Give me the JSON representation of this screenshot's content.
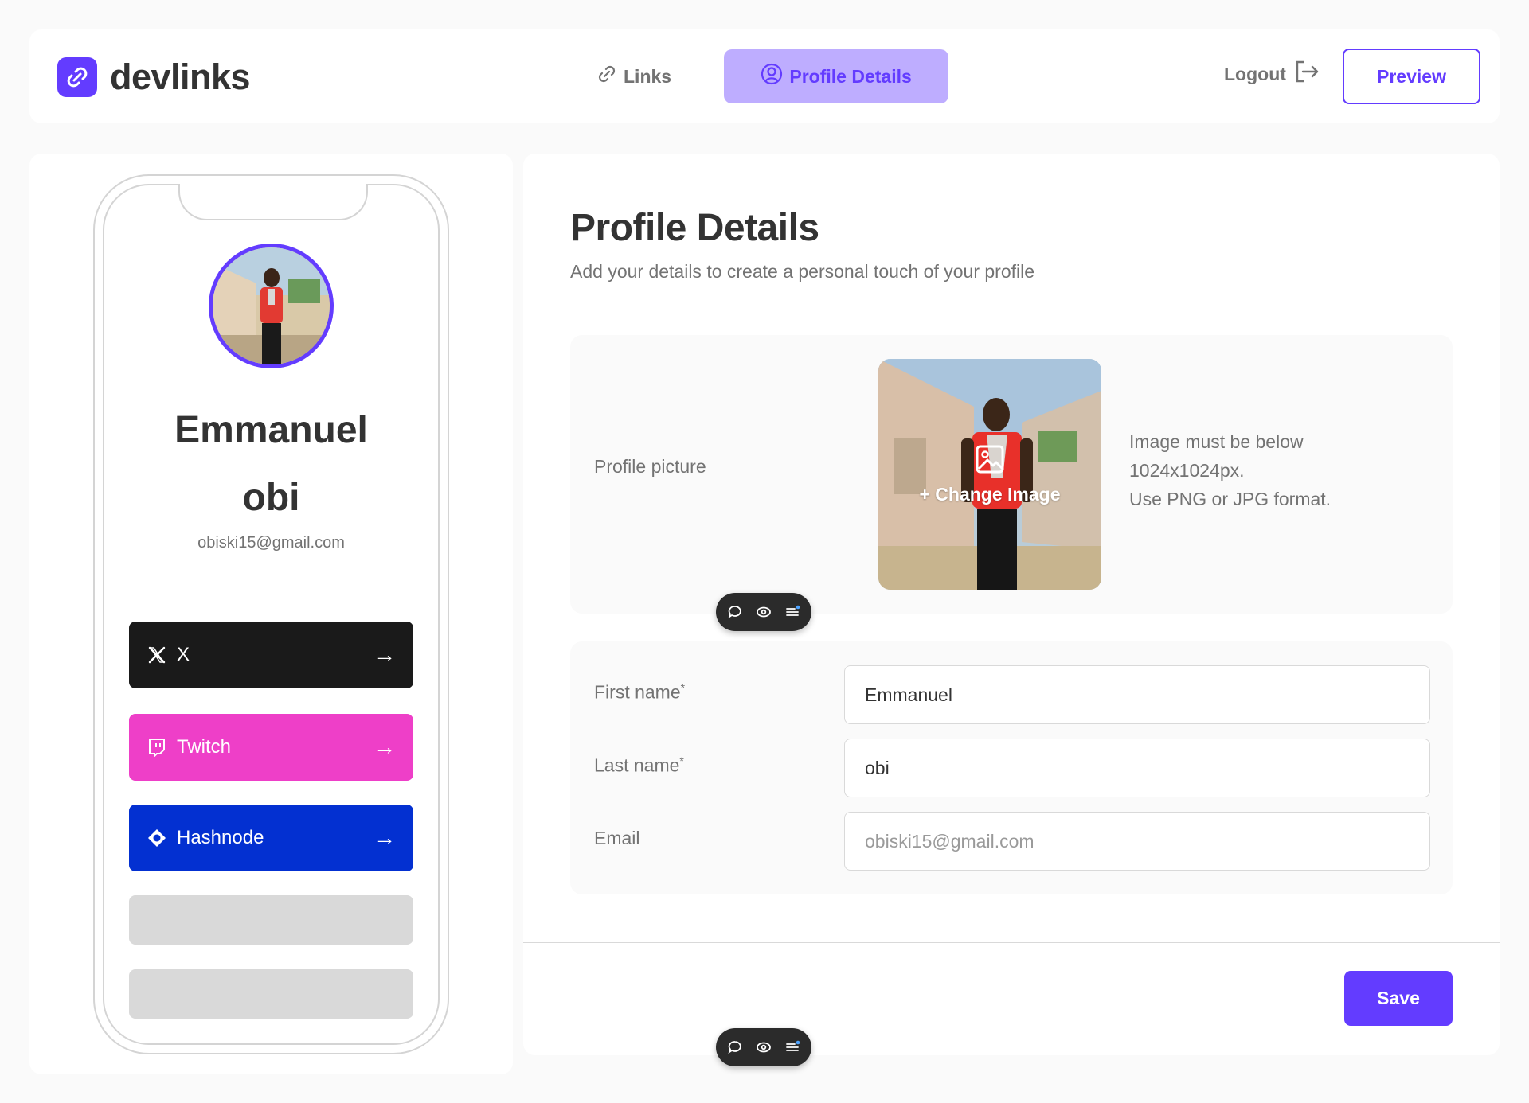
{
  "header": {
    "brand": "devlinks",
    "tabs": [
      {
        "label": "Links",
        "icon": "link-icon",
        "active": false
      },
      {
        "label": "Profile Details",
        "icon": "user-circle-icon",
        "active": true
      }
    ],
    "logout_label": "Logout",
    "preview_label": "Preview"
  },
  "phone_preview": {
    "first_name": "Emmanuel",
    "last_name": "obi",
    "email": "obiski15@gmail.com",
    "links": [
      {
        "platform": "X",
        "color": "#1a1a1a",
        "icon": "x-logo-icon"
      },
      {
        "platform": "Twitch",
        "color": "#ee3fc8",
        "icon": "twitch-icon"
      },
      {
        "platform": "Hashnode",
        "color": "#0330d1",
        "icon": "hashnode-icon"
      }
    ],
    "arrow": "→"
  },
  "profile": {
    "title": "Profile Details",
    "subtitle": "Add your details to create a personal touch of your profile",
    "picture_label": "Profile picture",
    "change_image_label": "+ Change Image",
    "image_hint": [
      "Image must be below",
      "1024x1024px.",
      "Use PNG or JPG format."
    ],
    "fields": [
      {
        "label": "First name",
        "required_mark": "*",
        "value": "Emmanuel",
        "placeholder": ""
      },
      {
        "label": "Last name",
        "required_mark": "*",
        "value": "obi",
        "placeholder": ""
      },
      {
        "label": "Email",
        "required_mark": "",
        "value": "",
        "placeholder": "obiski15@gmail.com"
      }
    ],
    "save_label": "Save"
  },
  "colors": {
    "accent": "#633cff",
    "accent_light": "#beadff",
    "text_dark": "#333333",
    "text_grey": "#737373",
    "border": "#d9d9d9"
  }
}
